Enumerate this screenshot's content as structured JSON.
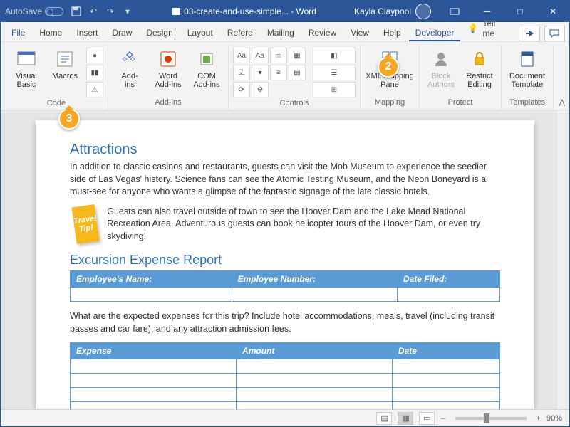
{
  "titlebar": {
    "autosave": "AutoSave",
    "doc_title": "03-create-and-use-simple... - Word",
    "user": "Kayla Claypool"
  },
  "menus": [
    "File",
    "Home",
    "Insert",
    "Draw",
    "Design",
    "Layout",
    "Refere",
    "Mailing",
    "Review",
    "View",
    "Help",
    "Developer"
  ],
  "active_menu": "Developer",
  "tell_me": "Tell me",
  "ribbon": {
    "groups": {
      "code": {
        "label": "Code",
        "visual_basic": "Visual Basic",
        "macros": "Macros"
      },
      "addins": {
        "label": "Add-ins",
        "addins": "Add-\nins",
        "word_addins": "Word\nAdd-ins",
        "com_addins": "COM\nAdd-ins"
      },
      "controls": {
        "label": "Controls"
      },
      "mapping": {
        "label": "Mapping",
        "xml": "XML Mapping\nPane"
      },
      "protect": {
        "label": "Protect",
        "block": "Block\nAuthors",
        "restrict": "Restrict\nEditing"
      },
      "templates": {
        "label": "Templates",
        "doc_template": "Document\nTemplate"
      }
    }
  },
  "doc": {
    "h1": "Attractions",
    "p1": "In addition to classic casinos and restaurants, guests can visit the Mob Museum to experience the seedier side of Las Vegas' history. Science fans can see the Atomic Testing Museum, and the Neon Boneyard is a must-see for anyone who wants a glimpse of the fantastic signage of the late classic hotels.",
    "tip_label": "Travel Tip!",
    "tip_text": "Guests can also travel outside of town to see the Hoover Dam and the Lake Mead National Recreation Area. Adventurous guests can book helicopter tours of the Hoover Dam, or even try skydiving!",
    "h2": "Excursion Expense Report",
    "t1": {
      "c1": "Employee's Name:",
      "c2": "Employee Number:",
      "c3": "Date Filed:"
    },
    "p2": "What are the expected expenses for this trip? Include hotel accommodations, meals, travel (including transit passes and car fare), and any attraction admission fees.",
    "t2": {
      "c1": "Expense",
      "c2": "Amount",
      "c3": "Date"
    }
  },
  "status": {
    "zoom": "90%",
    "plus": "+",
    "minus": "–"
  },
  "callouts": {
    "c2": "2",
    "c3": "3"
  }
}
